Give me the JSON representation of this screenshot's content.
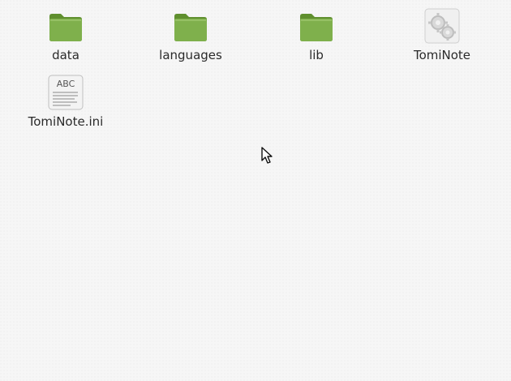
{
  "files": [
    {
      "name": "data",
      "type": "folder",
      "icon": "folder-icon"
    },
    {
      "name": "languages",
      "type": "folder",
      "icon": "folder-icon"
    },
    {
      "name": "lib",
      "type": "folder",
      "icon": "folder-icon"
    },
    {
      "name": "TomiNote",
      "type": "executable",
      "icon": "gear-icon"
    },
    {
      "name": "TomiNote.ini",
      "type": "text",
      "icon": "text-file-icon",
      "icon_text": "ABC"
    }
  ],
  "colors": {
    "background": "#f6f6f6",
    "folder": "#7fb04c",
    "folder_dark": "#5f8f2e",
    "icon_gray": "#e4e4e4"
  }
}
